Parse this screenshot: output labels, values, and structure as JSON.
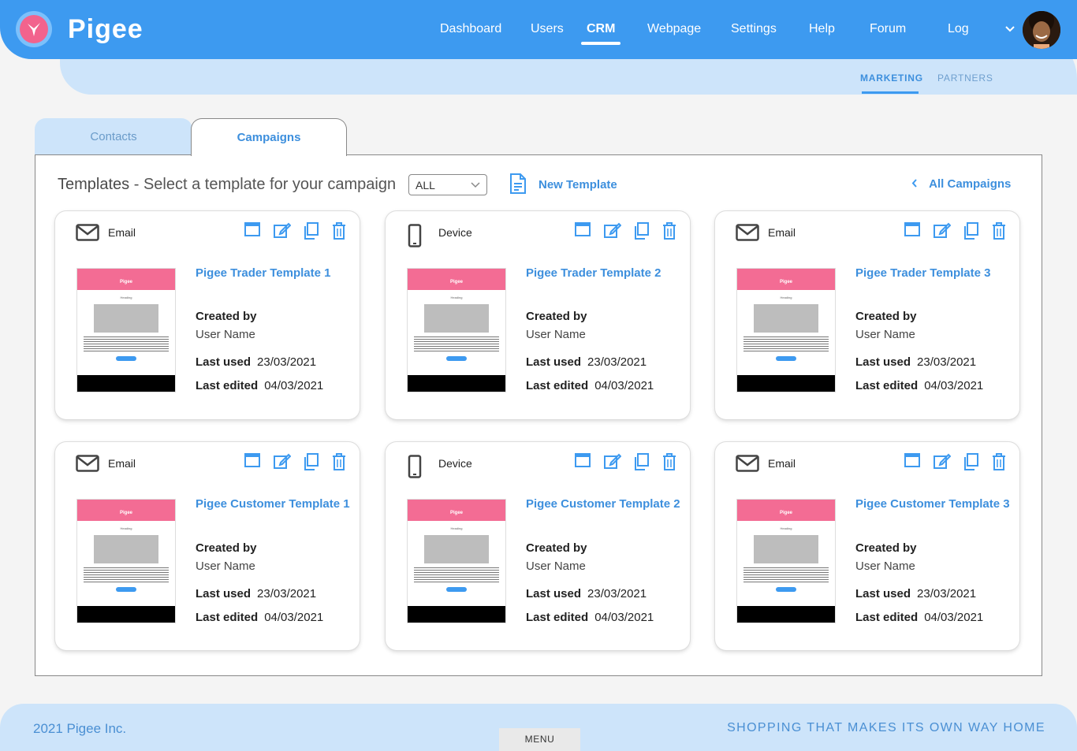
{
  "app": {
    "brand": "Pigee"
  },
  "nav": {
    "items": [
      {
        "label": "Dashboard"
      },
      {
        "label": "Users"
      },
      {
        "label": "CRM",
        "active": true
      },
      {
        "label": "Webpage"
      },
      {
        "label": "Settings"
      },
      {
        "label": "Help"
      },
      {
        "label": "Forum"
      },
      {
        "label": "Log"
      }
    ]
  },
  "subnav": {
    "marketing": "MARKETING",
    "partners": "PARTNERS"
  },
  "tabs": {
    "contacts": "Contacts",
    "campaigns": "Campaigns"
  },
  "toolbar": {
    "title": "Templates",
    "separator": " - ",
    "subtitle": "Select a template for your campaign",
    "filter_value": "ALL",
    "new_template": "New Template",
    "all_campaigns": "All Campaigns"
  },
  "labels": {
    "created_by": "Created by",
    "last_used": "Last used",
    "last_edited": "Last edited"
  },
  "templates": [
    {
      "type": "Email",
      "name": "Pigee Trader Template 1",
      "user": "User Name",
      "last_used": "23/03/2021",
      "last_edited": "04/03/2021"
    },
    {
      "type": "Device",
      "name": "Pigee Trader Template 2",
      "user": "User Name",
      "last_used": "23/03/2021",
      "last_edited": "04/03/2021"
    },
    {
      "type": "Email",
      "name": "Pigee Trader Template 3",
      "user": "User Name",
      "last_used": "23/03/2021",
      "last_edited": "04/03/2021"
    },
    {
      "type": "Email",
      "name": "Pigee Customer Template 1",
      "user": "User Name",
      "last_used": "23/03/2021",
      "last_edited": "04/03/2021"
    },
    {
      "type": "Device",
      "name": "Pigee Customer Template 2",
      "user": "User Name",
      "last_used": "23/03/2021",
      "last_edited": "04/03/2021"
    },
    {
      "type": "Email",
      "name": "Pigee Customer Template 3",
      "user": "User Name",
      "last_used": "23/03/2021",
      "last_edited": "04/03/2021"
    }
  ],
  "thumbnail": {
    "brand": "Pigee",
    "heading": "Heading"
  },
  "icons": {
    "email": "envelope-icon",
    "device": "phone-icon",
    "actions": [
      "preview-icon",
      "edit-icon",
      "duplicate-icon",
      "delete-icon"
    ]
  },
  "colors": {
    "primary": "#3d9af0",
    "accent": "#f36c94",
    "light": "#cde4fa"
  },
  "footer": {
    "copyright": "2021 Pigee Inc.",
    "menu": "MENU",
    "slogan": "SHOPPING THAT MAKES ITS OWN WAY HOME"
  }
}
